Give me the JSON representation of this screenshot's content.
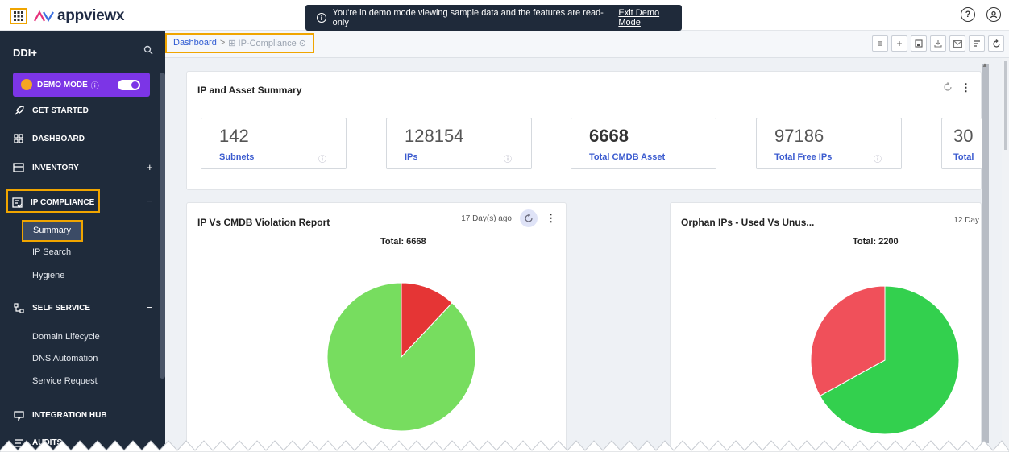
{
  "topbar": {
    "logo_text": "appviewx",
    "banner_text": "You're in demo mode viewing sample data and the features are read-only",
    "banner_link": "Exit Demo Mode",
    "icons": [
      "apps-grid-icon",
      "help-icon",
      "user-icon"
    ]
  },
  "sidebar": {
    "title": "DDI+",
    "demo_mode_label": "DEMO MODE",
    "demo_mode_on": true,
    "items": [
      {
        "label": "GET STARTED",
        "icon": "rocket-icon"
      },
      {
        "label": "DASHBOARD",
        "icon": "dashboard-icon"
      },
      {
        "label": "INVENTORY",
        "icon": "inventory-icon",
        "sign": "+"
      },
      {
        "label": "IP COMPLIANCE",
        "icon": "compliance-icon",
        "sign": "−"
      },
      {
        "label": "SELF SERVICE",
        "icon": "self-service-icon",
        "sign": "−"
      },
      {
        "label": "INTEGRATION HUB",
        "icon": "integration-icon"
      },
      {
        "label": "AUDITS",
        "icon": "audits-icon"
      }
    ],
    "ip_compliance_sub": [
      "Summary",
      "IP Search",
      "Hygiene"
    ],
    "self_service_sub": [
      "Domain Lifecycle",
      "DNS Automation",
      "Service Request"
    ]
  },
  "breadcrumb": {
    "root": "Dashboard",
    "separator": ">",
    "current": "IP-Compliance"
  },
  "summary": {
    "title": "IP and Asset Summary",
    "kpis": [
      {
        "value": "142",
        "label": "Subnets"
      },
      {
        "value": "128154",
        "label": "IPs"
      },
      {
        "value": "6668",
        "label": "Total CMDB Asset"
      },
      {
        "value": "97186",
        "label": "Total Free IPs"
      },
      {
        "value": "30",
        "label": "Total"
      }
    ]
  },
  "chart_data": [
    {
      "type": "pie",
      "title": "IP Vs CMDB Violation Report",
      "timestamp": "17 Day(s) ago",
      "total_label": "Total: 6668",
      "slices": [
        {
          "value": 0.88,
          "color": "#77dd5f"
        },
        {
          "value": 0.12,
          "color": "#e53535"
        }
      ]
    },
    {
      "type": "pie",
      "title": "Orphan IPs - Used Vs Unus...",
      "timestamp": "12 Day",
      "total_label": "Total: 2200",
      "slices": [
        {
          "value": 0.67,
          "color": "#33d04e"
        },
        {
          "value": 0.33,
          "color": "#f0505a"
        }
      ]
    }
  ]
}
